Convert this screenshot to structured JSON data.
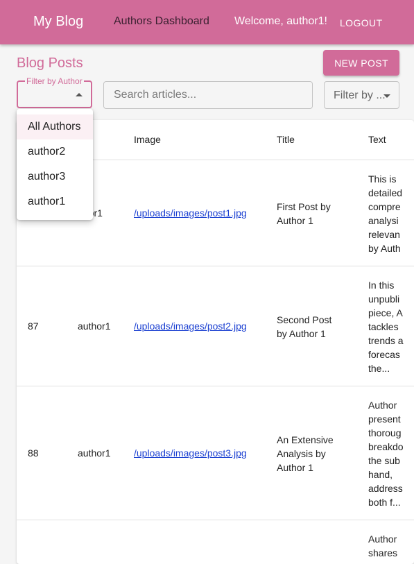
{
  "header": {
    "brand": "My Blog",
    "nav_link": "Authors Dashboard",
    "welcome": "Welcome, author1!",
    "logout": "LOGOUT"
  },
  "toolbar": {
    "page_title": "Blog Posts",
    "new_post": "NEW POST",
    "author_filter_label": "Filter by Author",
    "search_placeholder": "Search articles...",
    "filter_by_label": "Filter by ..."
  },
  "author_menu": {
    "items": [
      "All Authors",
      "author2",
      "author3",
      "author1"
    ]
  },
  "table": {
    "headers": {
      "author": "hor",
      "image": "Image",
      "title": "Title",
      "text": "Text"
    },
    "rows": [
      {
        "id": "",
        "author": "thor1",
        "image": "/uploads/images/post1.jpg",
        "title": "First Post by\nAuthor 1",
        "text": "This is\ndetailed\ncompre\nanalysi\nrelevan\nby Auth"
      },
      {
        "id": "87",
        "author": "author1",
        "image": "/uploads/images/post2.jpg",
        "title": "Second Post\nby Author 1",
        "text": "In this\nunpubli\npiece, A\ntackles\ntrends a\nforecas\nthe..."
      },
      {
        "id": "88",
        "author": "author1",
        "image": "/uploads/images/post3.jpg",
        "title": "An Extensive\nAnalysis by\nAuthor 1",
        "text": "Author\npresent\nthoroug\nbreakdo\nthe sub\nhand,\naddress\nboth f..."
      },
      {
        "id": "",
        "author": "",
        "image": "",
        "title": "",
        "text": "Author\nshares"
      }
    ]
  },
  "colors": {
    "brand": "#d16b99",
    "link": "#1a3fd1"
  }
}
